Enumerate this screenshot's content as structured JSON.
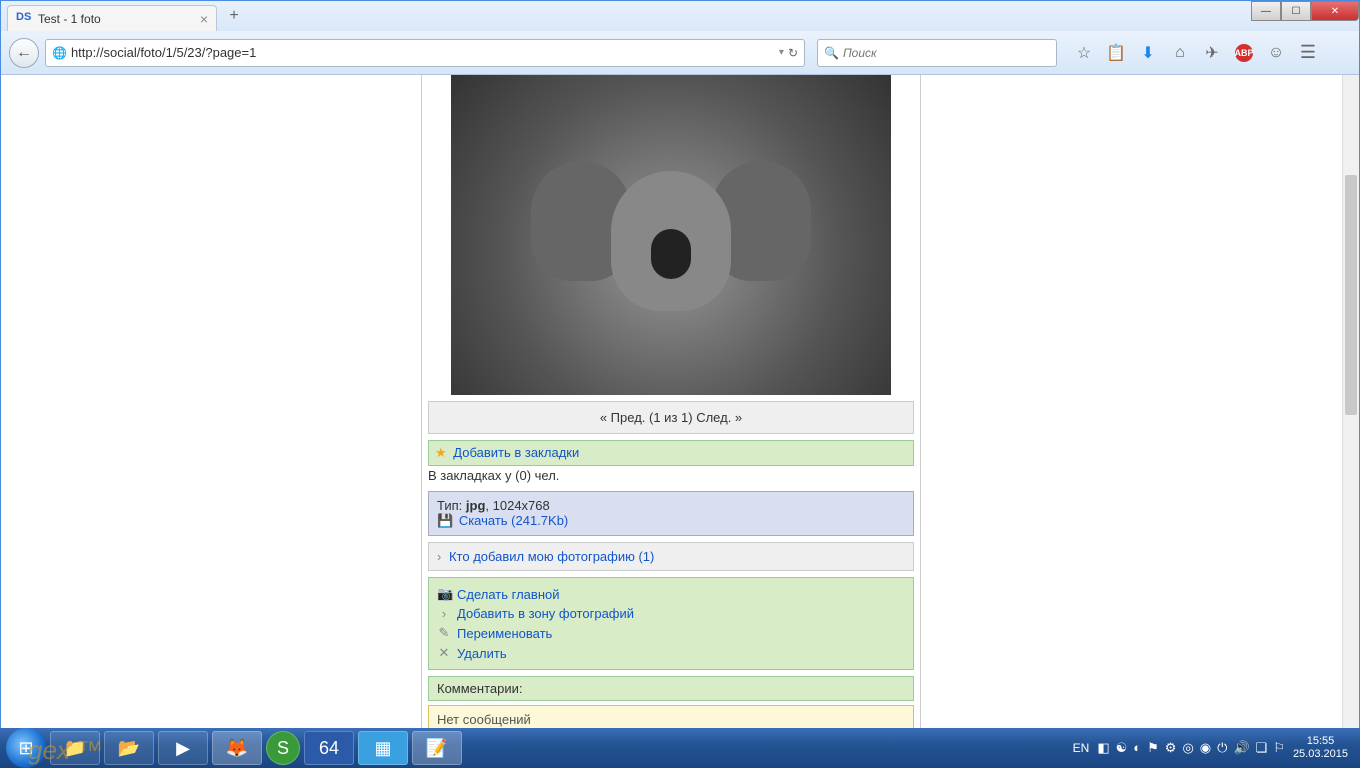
{
  "window": {
    "tab_title": "Test - 1 foto",
    "favicon_text": "DS"
  },
  "nav": {
    "url": "http://social/foto/1/5/23/?page=1",
    "search_placeholder": "Поиск"
  },
  "page": {
    "pagination": "« Пред. (1 из 1) След. »",
    "add_bookmark": "Добавить в закладки",
    "bookmarked_by": "В закладках у (0) чел.",
    "file_type_label": "Тип: ",
    "file_type": "jpg",
    "file_dims": ", 1024x768",
    "download": "Скачать (241.7Kb)",
    "who_added": "Кто добавил мою фотографию (1)",
    "actions": {
      "make_main": "Сделать главной",
      "add_to_zone": "Добавить в зону фотографий",
      "rename": "Переименовать",
      "delete": "Удалить"
    },
    "comments_header": "Комментарии:",
    "no_comments": "Нет сообщений"
  },
  "tray": {
    "lang": "EN",
    "time": "15:55",
    "date": "25.03.2015"
  },
  "watermark": "gex ™"
}
